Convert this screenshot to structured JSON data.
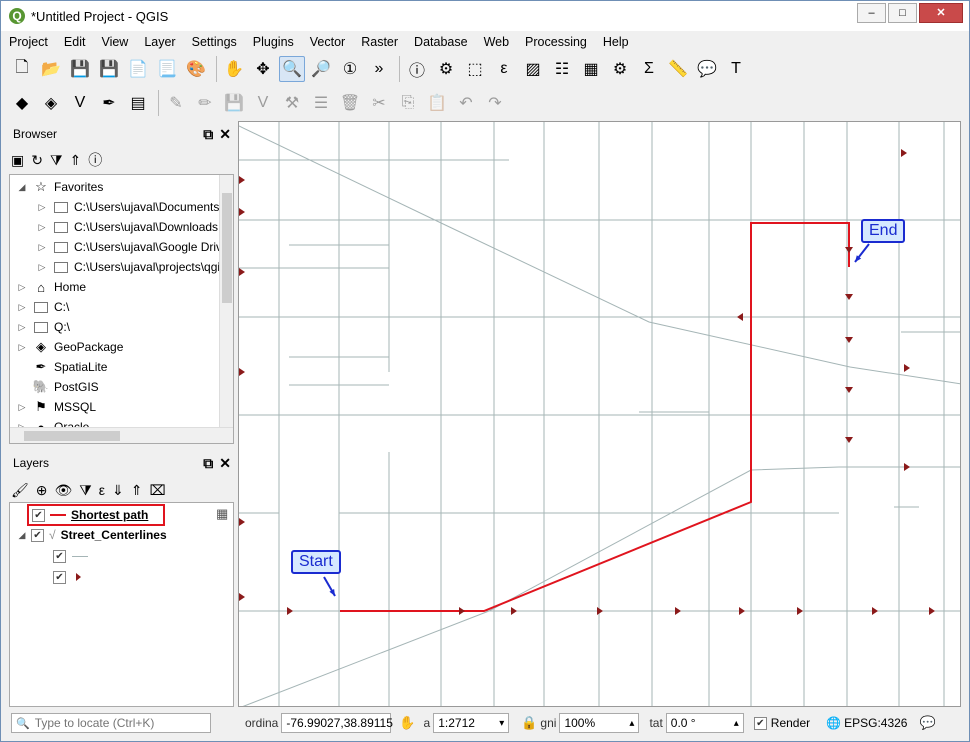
{
  "window": {
    "title": "*Untitled Project - QGIS",
    "logo": "Q",
    "minimize": "–",
    "maximize": "□",
    "close": "✕"
  },
  "menu": [
    "Project",
    "Edit",
    "View",
    "Layer",
    "Settings",
    "Plugins",
    "Vector",
    "Raster",
    "Database",
    "Web",
    "Processing",
    "Help"
  ],
  "toolbar1": [
    {
      "name": "new-project-icon",
      "glyph": "🗋"
    },
    {
      "name": "open-project-icon",
      "glyph": "📂"
    },
    {
      "name": "save-project-icon",
      "glyph": "💾"
    },
    {
      "name": "save-as-icon",
      "glyph": "💾"
    },
    {
      "name": "new-print-layout-icon",
      "glyph": "📄"
    },
    {
      "name": "layout-manager-icon",
      "glyph": "📃"
    },
    {
      "name": "style-manager-icon",
      "glyph": "🎨"
    },
    {
      "name": "pan-icon",
      "glyph": "✋"
    },
    {
      "name": "pan-to-selection-icon",
      "glyph": "✥"
    },
    {
      "name": "zoom-in-icon",
      "glyph": "🔍"
    },
    {
      "name": "zoom-out-icon",
      "glyph": "🔎"
    },
    {
      "name": "zoom-native-icon",
      "glyph": "①"
    }
  ],
  "toolbar1_more": "»",
  "toolbar1b": [
    {
      "name": "identify-icon",
      "glyph": "ⓘ"
    },
    {
      "name": "run-feature-action-icon",
      "glyph": "⚙"
    },
    {
      "name": "select-features-icon",
      "glyph": "⬚"
    },
    {
      "name": "select-by-expression-icon",
      "glyph": "ε"
    },
    {
      "name": "deselect-icon",
      "glyph": "▨"
    },
    {
      "name": "attribute-table-icon",
      "glyph": "☷"
    },
    {
      "name": "field-calculator-icon",
      "glyph": "▦"
    },
    {
      "name": "processing-toolbox-icon",
      "glyph": "⚙"
    },
    {
      "name": "statistical-summary-icon",
      "glyph": "Σ"
    },
    {
      "name": "measure-icon",
      "glyph": "📏"
    },
    {
      "name": "map-tips-icon",
      "glyph": "💬"
    },
    {
      "name": "text-annotation-icon",
      "glyph": "T"
    }
  ],
  "toolbar2": [
    {
      "name": "data-source-manager-icon",
      "glyph": "◆"
    },
    {
      "name": "new-geopackage-layer-icon",
      "glyph": "◈"
    },
    {
      "name": "digitize-vertex-icon",
      "glyph": "V"
    },
    {
      "name": "digitize-pen-icon",
      "glyph": "✒"
    },
    {
      "name": "new-virtual-layer-icon",
      "glyph": "▤"
    }
  ],
  "toolbar2_disabled": [
    {
      "name": "current-edits-icon",
      "glyph": "✎"
    },
    {
      "name": "toggle-editing-icon",
      "glyph": "✏"
    },
    {
      "name": "save-layer-edits-icon",
      "glyph": "💾"
    },
    {
      "name": "add-feature-icon",
      "glyph": "V"
    },
    {
      "name": "vertex-tool-icon",
      "glyph": "⚒"
    },
    {
      "name": "modify-attributes-icon",
      "glyph": "☰"
    },
    {
      "name": "delete-selected-icon",
      "glyph": "🗑"
    },
    {
      "name": "cut-features-icon",
      "glyph": "✂"
    },
    {
      "name": "copy-features-icon",
      "glyph": "⎘"
    },
    {
      "name": "paste-features-icon",
      "glyph": "📋"
    },
    {
      "name": "undo-icon",
      "glyph": "↶"
    },
    {
      "name": "redo-icon",
      "glyph": "↷"
    }
  ],
  "browser": {
    "title": "Browser",
    "float": "⧉",
    "close": "✕",
    "tools": [
      {
        "name": "add-selected-layers-icon",
        "glyph": "▣"
      },
      {
        "name": "refresh-icon",
        "glyph": "↻"
      },
      {
        "name": "filter-icon",
        "glyph": "⧩"
      },
      {
        "name": "collapse-all-icon",
        "glyph": "⇑"
      },
      {
        "name": "properties-icon",
        "glyph": "ⓘ"
      }
    ],
    "items": [
      {
        "label": "Favorites",
        "indent": 0,
        "exp": "◢",
        "icon": "star-icon",
        "glyph": "☆"
      },
      {
        "label": "C:\\Users\\ujaval\\Documents",
        "indent": 1,
        "exp": "▷",
        "icon": "folder-icon",
        "glyph": ""
      },
      {
        "label": "C:\\Users\\ujaval\\Downloads",
        "indent": 1,
        "exp": "▷",
        "icon": "folder-icon",
        "glyph": ""
      },
      {
        "label": "C:\\Users\\ujaval\\Google Drive",
        "indent": 1,
        "exp": "▷",
        "icon": "folder-icon",
        "glyph": ""
      },
      {
        "label": "C:\\Users\\ujaval\\projects\\qgis",
        "indent": 1,
        "exp": "▷",
        "icon": "folder-icon",
        "glyph": ""
      },
      {
        "label": "Home",
        "indent": 0,
        "exp": "▷",
        "icon": "home-icon",
        "glyph": "⌂"
      },
      {
        "label": "C:\\",
        "indent": 0,
        "exp": "▷",
        "icon": "folder-icon",
        "glyph": ""
      },
      {
        "label": "Q:\\",
        "indent": 0,
        "exp": "▷",
        "icon": "folder-icon",
        "glyph": ""
      },
      {
        "label": "GeoPackage",
        "indent": 0,
        "exp": "▷",
        "icon": "geopackage-icon",
        "glyph": "◈"
      },
      {
        "label": "SpatiaLite",
        "indent": 0,
        "exp": "",
        "icon": "spatialite-icon",
        "glyph": "✒"
      },
      {
        "label": "PostGIS",
        "indent": 0,
        "exp": "",
        "icon": "postgis-icon",
        "glyph": "🐘"
      },
      {
        "label": "MSSQL",
        "indent": 0,
        "exp": "▷",
        "icon": "mssql-icon",
        "glyph": "⚑"
      },
      {
        "label": "Oracle",
        "indent": 0,
        "exp": "▷",
        "icon": "oracle-icon",
        "glyph": "●"
      }
    ]
  },
  "layers": {
    "title": "Layers",
    "float": "⧉",
    "close": "✕",
    "tools": [
      {
        "name": "open-layer-styling-icon",
        "glyph": "🖌"
      },
      {
        "name": "add-group-icon",
        "glyph": "⊕"
      },
      {
        "name": "manage-visibility-icon",
        "glyph": "👁"
      },
      {
        "name": "filter-legend-icon",
        "glyph": "⧩"
      },
      {
        "name": "filter-by-expression-icon",
        "glyph": "ε"
      },
      {
        "name": "expand-all-icon",
        "glyph": "⇓"
      },
      {
        "name": "collapse-all-layers-icon",
        "glyph": "⇑"
      },
      {
        "name": "remove-layer-icon",
        "glyph": "⌧"
      }
    ],
    "items": [
      {
        "label": "Shortest path",
        "check": "✔"
      },
      {
        "label": "Street_Centerlines",
        "check": "✔"
      }
    ],
    "sub_check": "✔",
    "mem_icon": "▦",
    "expand_glyph": "◢"
  },
  "map": {
    "start_label": "Start",
    "end_label": "End",
    "route_color": "#e0141e",
    "street_color": "#a5b5b6",
    "arrow_color": "#8b1a1a",
    "callout_color": "#1a2bd0"
  },
  "status": {
    "search_placeholder": "Type to locate (Ctrl+K)",
    "coord_label": "ordina",
    "coordinate": "-76.99027,38.89115",
    "scale_label": "a",
    "scale": "1:2712",
    "mag_label": "gni",
    "magnifier": "100%",
    "rot_label": "tat",
    "rotation": "0.0 °",
    "render_label": "Render",
    "render_check": "✔",
    "crs": "EPSG:4326",
    "lock_glyph": "🔒",
    "extents_glyph": "✋",
    "globe_glyph": "🌐",
    "messages_glyph": "💬",
    "search_glyph": "🔍",
    "spin_glyph": "▴",
    "dropdown_glyph": "▾"
  }
}
